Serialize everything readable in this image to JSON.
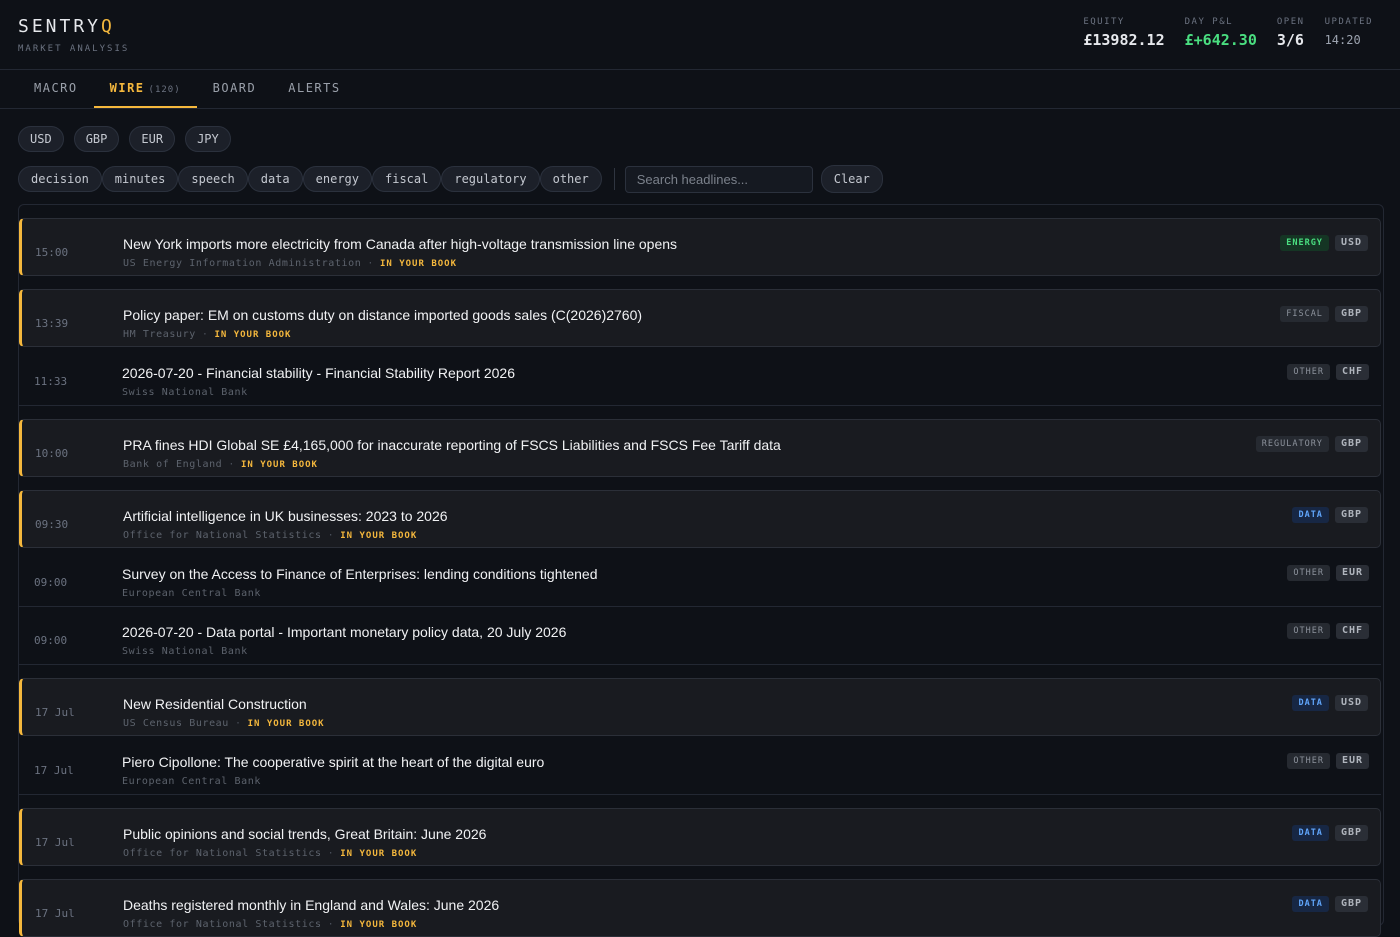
{
  "brand": {
    "logo_main": "SENTRY",
    "logo_accent": "Q",
    "tagline": "MARKET ANALYSIS"
  },
  "stats": [
    {
      "label": "EQUITY",
      "value": "£13982.12"
    },
    {
      "label": "DAY P&L",
      "value": "£+642.30"
    },
    {
      "label": "OPEN",
      "value": "3/6"
    },
    {
      "label": "UPDATED",
      "value": "14:20"
    }
  ],
  "colors": {
    "accent": "#f5b83d",
    "positive": "#4ade80",
    "data": "#60a5fa"
  },
  "tabs": [
    {
      "label": "MACRO"
    },
    {
      "label": "WIRE",
      "count": "(120)"
    },
    {
      "label": "BOARD"
    },
    {
      "label": "ALERTS"
    }
  ],
  "currencies": [
    "USD",
    "GBP",
    "EUR",
    "JPY"
  ],
  "categories": [
    "decision",
    "minutes",
    "speech",
    "data",
    "energy",
    "fiscal",
    "regulatory",
    "other"
  ],
  "search": {
    "placeholder": "Search headlines...",
    "value": ""
  },
  "clear_label": "Clear",
  "in_book_label": "IN YOUR BOOK",
  "items": [
    {
      "time": "15:00",
      "title": "New York imports more electricity from Canada after high-voltage transmission line opens",
      "source": "US Energy Information Administration",
      "in_book": true,
      "category": "ENERGY",
      "currency": "USD"
    },
    {
      "time": "13:39",
      "title": "Policy paper: EM on customs duty on distance imported goods sales (C(2026)2760)",
      "source": "HM Treasury",
      "in_book": true,
      "category": "FISCAL",
      "currency": "GBP"
    },
    {
      "time": "11:33",
      "title": "2026-07-20 - Financial stability - Financial Stability Report 2026",
      "source": "Swiss National Bank",
      "in_book": false,
      "category": "OTHER",
      "currency": "CHF"
    },
    {
      "time": "10:00",
      "title": "PRA fines HDI Global SE £4,165,000 for inaccurate reporting of FSCS Liabilities and FSCS Fee Tariff data",
      "source": "Bank of England",
      "in_book": true,
      "category": "REGULATORY",
      "currency": "GBP"
    },
    {
      "time": "09:30",
      "title": "Artificial intelligence in UK businesses: 2023 to 2026",
      "source": "Office for National Statistics",
      "in_book": true,
      "category": "DATA",
      "currency": "GBP"
    },
    {
      "time": "09:00",
      "title": "Survey on the Access to Finance of Enterprises: lending conditions tightened",
      "source": "European Central Bank",
      "in_book": false,
      "category": "OTHER",
      "currency": "EUR"
    },
    {
      "time": "09:00",
      "title": "2026-07-20 - Data portal - Important monetary policy data, 20 July 2026",
      "source": "Swiss National Bank",
      "in_book": false,
      "category": "OTHER",
      "currency": "CHF"
    },
    {
      "time": "17 Jul",
      "title": "New Residential Construction",
      "source": "US Census Bureau",
      "in_book": true,
      "category": "DATA",
      "currency": "USD"
    },
    {
      "time": "17 Jul",
      "title": "Piero Cipollone: The cooperative spirit at the heart of the digital euro",
      "source": "European Central Bank",
      "in_book": false,
      "category": "OTHER",
      "currency": "EUR"
    },
    {
      "time": "17 Jul",
      "title": "Public opinions and social trends, Great Britain: June 2026",
      "source": "Office for National Statistics",
      "in_book": true,
      "category": "DATA",
      "currency": "GBP"
    },
    {
      "time": "17 Jul",
      "title": "Deaths registered monthly in England and Wales: June 2026",
      "source": "Office for National Statistics",
      "in_book": true,
      "category": "DATA",
      "currency": "GBP"
    }
  ]
}
